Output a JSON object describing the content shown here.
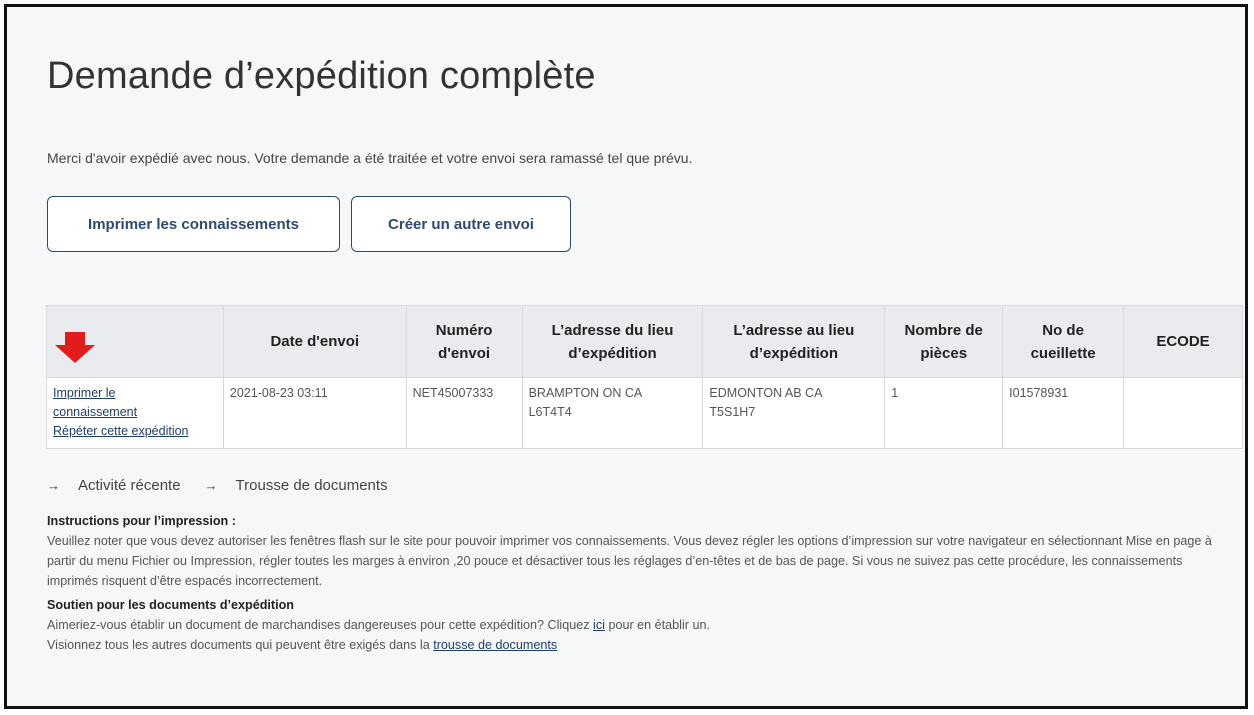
{
  "page": {
    "title": "Demande d’expédition complète",
    "intro": "Merci d'avoir expédié avec nous. Votre demande a été traitée et votre envoi sera ramassé tel que prévu."
  },
  "buttons": {
    "print_bills": "Imprimer les connaissements",
    "create_another": "Créer un autre envoi"
  },
  "table": {
    "headers": {
      "date": "Date d'envoi",
      "numero": "Numéro d'envoi",
      "from": "L’adresse du lieu d’expédition",
      "to": "L’adresse au lieu d’expédition",
      "pieces": "Nombre de pièces",
      "pickup": "No de cueillette",
      "ecode": "ECODE"
    },
    "row": {
      "print_link": "Imprimer le connaissement",
      "repeat_link": "Répéter cette expédition",
      "date": "2021-08-23 03:11",
      "numero": "NET45007333",
      "from_line1": "BRAMPTON ON CA",
      "from_line2": "L6T4T4",
      "to_line1": "EDMONTON AB CA",
      "to_line2": "T5S1H7",
      "pieces": "1",
      "pickup": "I01578931",
      "ecode": ""
    }
  },
  "links": {
    "recent": "Activité récente",
    "kit": "Trousse de documents"
  },
  "instructions": {
    "heading": "Instructions pour l’impression :",
    "body": "Veuillez noter que vous devez autoriser les fenêtres flash sur le site pour pouvoir imprimer vos connaissements. Vous devez régler les options d’impression sur votre navigateur en sélectionnant Mise en page à partir du menu Fichier ou Impression, régler toutes les marges à environ ,20 pouce et désactiver tous les réglages d’en-têtes et de bas de page. Si vous ne suivez pas cette procédure, les connaissements imprimés risquent d’être espacés incorrectement."
  },
  "support": {
    "heading": "Soutien pour les documents d’expédition",
    "line1_before": "Aimeriez-vous établir un document de marchandises dangereuses pour cette expédition? Cliquez ",
    "line1_link": "ici",
    "line1_after": " pour en établir un.",
    "line2_before": "Visionnez tous les autres documents qui peuvent être exigés dans la ",
    "line2_link": "trousse de documents"
  },
  "icons": {
    "arrow_color": "#e21c1c",
    "link_arrow": "→"
  }
}
